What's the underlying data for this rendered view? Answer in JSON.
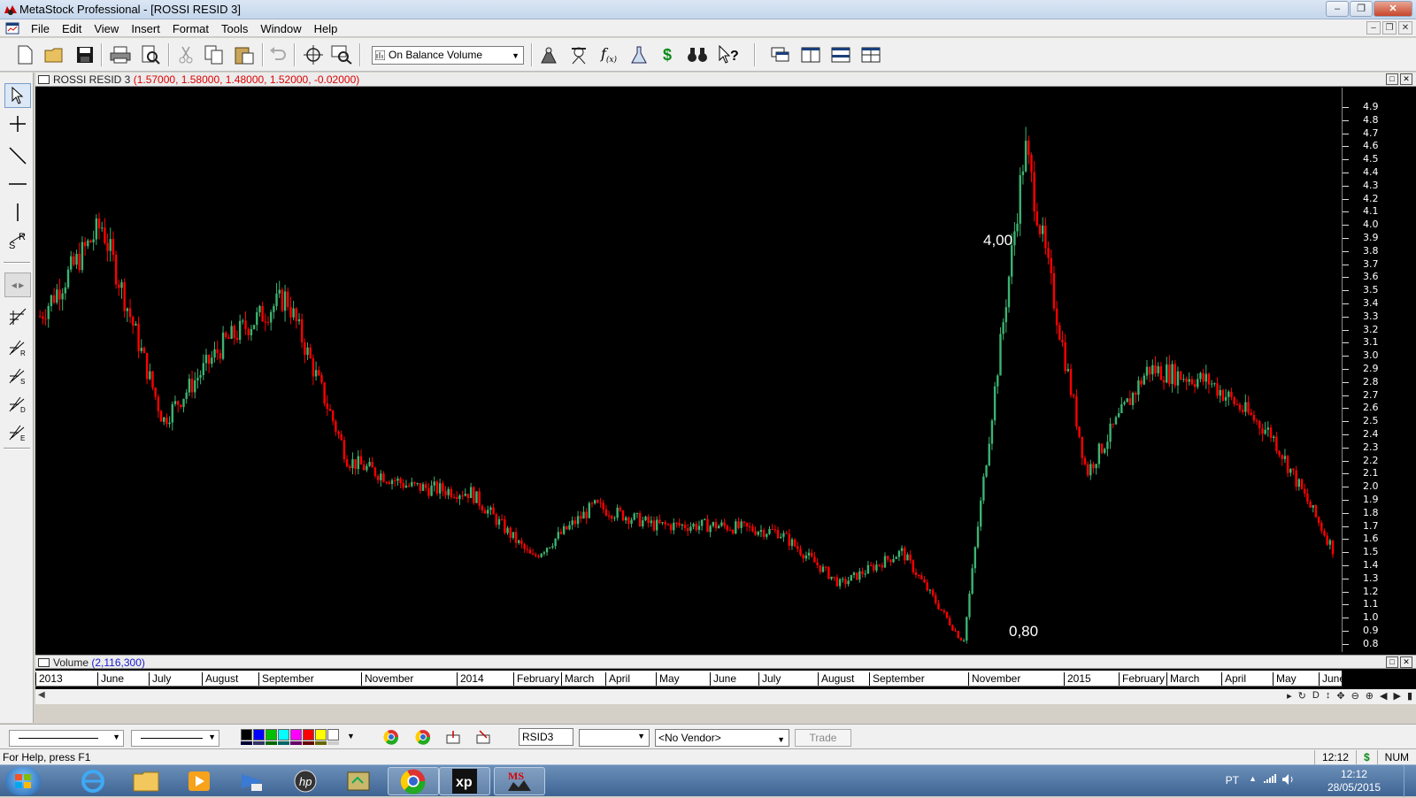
{
  "window": {
    "title": "MetaStock Professional - [ROSSI RESID 3]"
  },
  "menu": [
    "File",
    "Edit",
    "View",
    "Insert",
    "Format",
    "Tools",
    "Window",
    "Help"
  ],
  "toolbar": {
    "indicator_value": "On Balance Volume"
  },
  "chart": {
    "title": "ROSSI RESID 3",
    "ohlc": "(1.57000, 1.58000, 1.48000, 1.52000, -0.02000)",
    "annotation_high": "4,00",
    "annotation_low": "0,80",
    "price_ticks": [
      "4.9",
      "4.8",
      "4.7",
      "4.6",
      "4.5",
      "4.4",
      "4.3",
      "4.2",
      "4.1",
      "4.0",
      "3.9",
      "3.8",
      "3.7",
      "3.6",
      "3.5",
      "3.4",
      "3.3",
      "3.2",
      "3.1",
      "3.0",
      "2.9",
      "2.8",
      "2.7",
      "2.6",
      "2.5",
      "2.4",
      "2.3",
      "2.2",
      "2.1",
      "2.0",
      "1.9",
      "1.8",
      "1.7",
      "1.6",
      "1.5",
      "1.4",
      "1.3",
      "1.2",
      "1.1",
      "1.0",
      "0.9",
      "0.8"
    ],
    "volume_title": "Volume",
    "volume_value": "(2,116,300)",
    "date_labels": [
      "2013",
      "June",
      "July",
      "August",
      "September",
      "November",
      "2014",
      "February",
      "March",
      "April",
      "May",
      "June",
      "July",
      "August",
      "September",
      "November",
      "2015",
      "February",
      "March",
      "April",
      "May",
      "June"
    ],
    "colors": {
      "up": "#3cb371",
      "down": "#ff0000",
      "background": "#000000"
    }
  },
  "chart_data": {
    "type": "candlestick",
    "title": "ROSSI RESID 3",
    "ylim": [
      0.8,
      4.9
    ],
    "x": [
      "2013",
      "June",
      "July",
      "August",
      "September",
      "November",
      "2014",
      "February",
      "March",
      "April",
      "May",
      "June",
      "July",
      "August",
      "September",
      "November",
      "2015",
      "February",
      "March",
      "April",
      "May",
      "June"
    ],
    "close": [
      3.3,
      4.0,
      2.5,
      3.1,
      3.45,
      2.2,
      2.0,
      1.95,
      1.45,
      1.85,
      1.7,
      1.7,
      1.65,
      1.25,
      1.5,
      0.8,
      4.6,
      2.1,
      2.9,
      2.8,
      2.4,
      1.52
    ],
    "annotations": [
      {
        "text": "4,00",
        "y": 4.0
      },
      {
        "text": "0,80",
        "y": 0.8
      }
    ]
  },
  "bottom": {
    "symbol": "RSID3",
    "vendor": "<No Vendor>",
    "trade_label": "Trade",
    "swatch_colors": [
      "#000000",
      "#0000ff",
      "#00c000",
      "#00ffff",
      "#ff00ff",
      "#ff0000",
      "#ffff00",
      "#ffffff"
    ]
  },
  "status": {
    "help": "For Help, press F1",
    "time": "12:12",
    "currency": "$",
    "num": "NUM"
  },
  "taskbar": {
    "lang": "PT",
    "clock_time": "12:12",
    "clock_date": "28/05/2015"
  }
}
